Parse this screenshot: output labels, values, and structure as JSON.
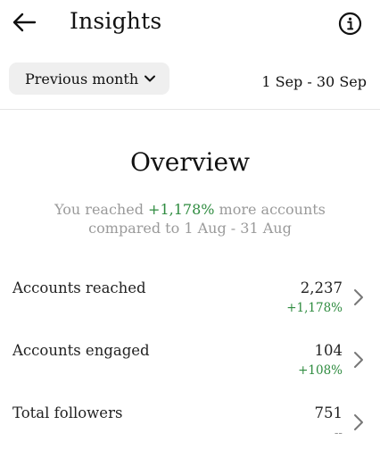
{
  "header": {
    "title": "Insights",
    "back_icon": "arrow-left-icon",
    "info_icon": "info-circle-icon"
  },
  "filter": {
    "period_label": "Previous month",
    "period_icon": "chevron-down-icon",
    "date_range": "1 Sep - 30 Sep"
  },
  "overview": {
    "title": "Overview",
    "summary_prefix": "You reached ",
    "summary_pct": "+1,178%",
    "summary_suffix": " more accounts",
    "summary_line2": "compared to 1 Aug - 31 Aug"
  },
  "metrics": [
    {
      "label": "Accounts reached",
      "value": "2,237",
      "change": "+1,178%"
    },
    {
      "label": "Accounts engaged",
      "value": "104",
      "change": "+108%"
    },
    {
      "label": "Total followers",
      "value": "751",
      "change": "--"
    }
  ],
  "colors": {
    "positive": "#2e8b3f",
    "muted": "#9a9a9a",
    "chip_bg": "#efefef"
  }
}
